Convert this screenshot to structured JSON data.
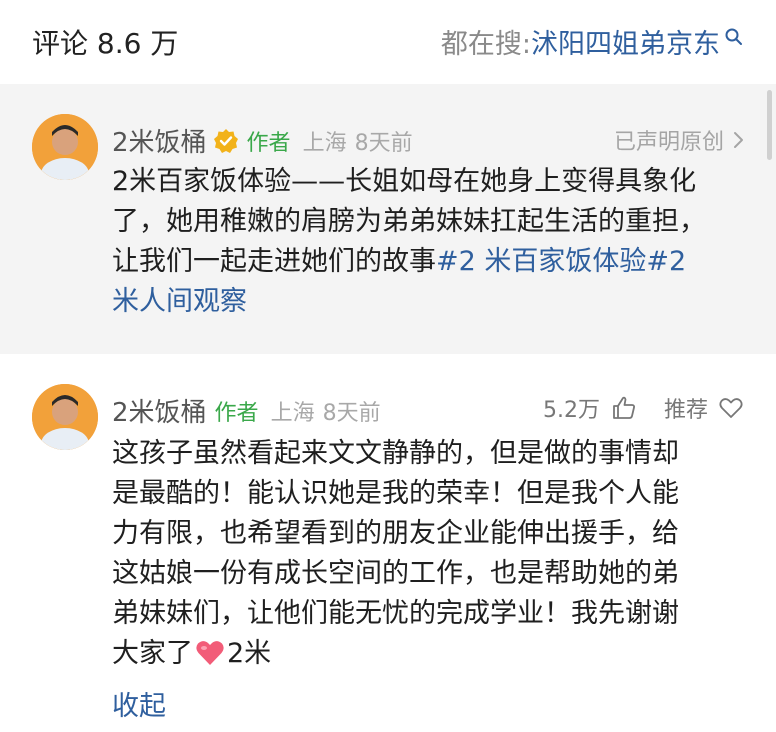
{
  "header": {
    "comments_label": "评论 8.6 万",
    "search_prefix": "都在搜: ",
    "search_term": "沭阳四姐弟京东"
  },
  "pinned_comment": {
    "username": "2米饭桶",
    "author_tag": "作者",
    "location": "上海",
    "time": "8天前",
    "original_claim": "已声明原创",
    "text_line1": "2米百家饭体验——长姐如母在她身上变得具象化",
    "text_line2": "了，她用稚嫩的肩膀为弟弟妹妹扛起生活的重担，",
    "text_line3": "让我们一起走进她们的故事",
    "hashtag1_part1": "#2 米百家饭体验",
    "hashtag2_part1": "#2",
    "hashtag2_part2": "米人间观察"
  },
  "reply_comment": {
    "username": "2米饭桶",
    "author_tag": "作者",
    "location": "上海",
    "time": "8天前",
    "like_count": "5.2万",
    "recommend_label": "推荐",
    "line1": "这孩子虽然看起来文文静静的，但是做的事情却",
    "line2": "是最酷的！能认识她是我的荣幸！但是我个人能",
    "line3": "力有限，也希望看到的朋友企业能伸出援手，给",
    "line4": "这姑娘一份有成长空间的工作，也是帮助她的弟",
    "line5": "弟妹妹们，让他们能无忧的完成学业！我先谢谢",
    "line6_before": "大家了",
    "line6_after": "2米",
    "collapse_label": "收起"
  },
  "colors": {
    "link_blue": "#2f5f9e",
    "author_green": "#3aa84a",
    "pinned_bg": "#f4f4f4"
  }
}
